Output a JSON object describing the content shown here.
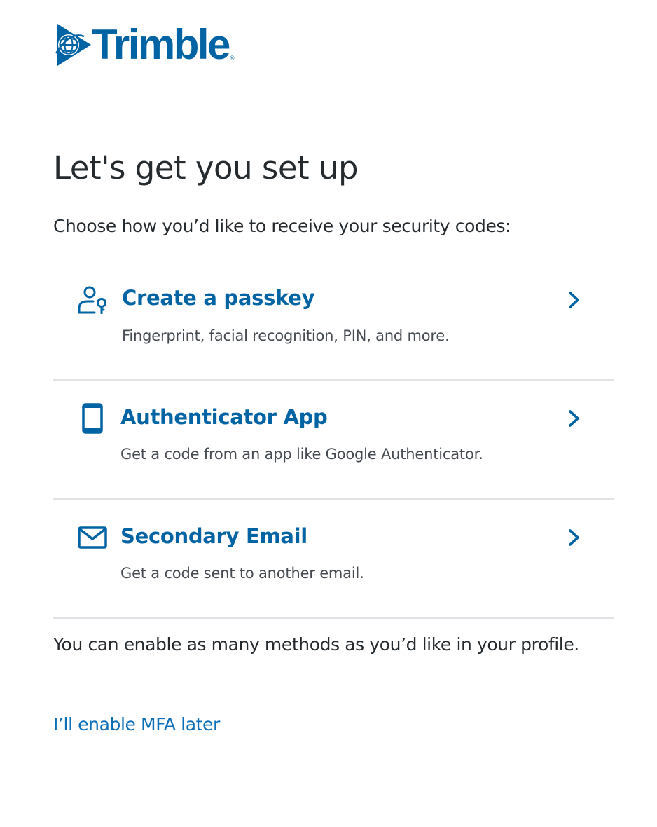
{
  "brand": {
    "name": "Trimble",
    "registered_mark": "®",
    "color": "#0063a3",
    "icon": "trimble-globe-logo"
  },
  "page": {
    "title": "Let's get you set up",
    "subtitle": "Choose how you’d like to receive your security codes:"
  },
  "options": [
    {
      "title": "Create a passkey",
      "description": "Fingerprint, facial recognition, PIN, and more.",
      "icon": "user-key-icon"
    },
    {
      "title": "Authenticator App",
      "description": "Get a code from an app like Google Authenticator.",
      "icon": "mobile-phone-icon"
    },
    {
      "title": "Secondary Email",
      "description": "Get a code sent to another email.",
      "icon": "envelope-icon"
    }
  ],
  "footer": {
    "note": "You can enable as many methods as you’d like in your profile.",
    "skip_link": "I’ll enable MFA later"
  },
  "colors": {
    "accent": "#0063a3",
    "link": "#0d6fb8",
    "text": "#252a2e",
    "muted_text": "#464b52",
    "divider": "#e2e2e7"
  }
}
